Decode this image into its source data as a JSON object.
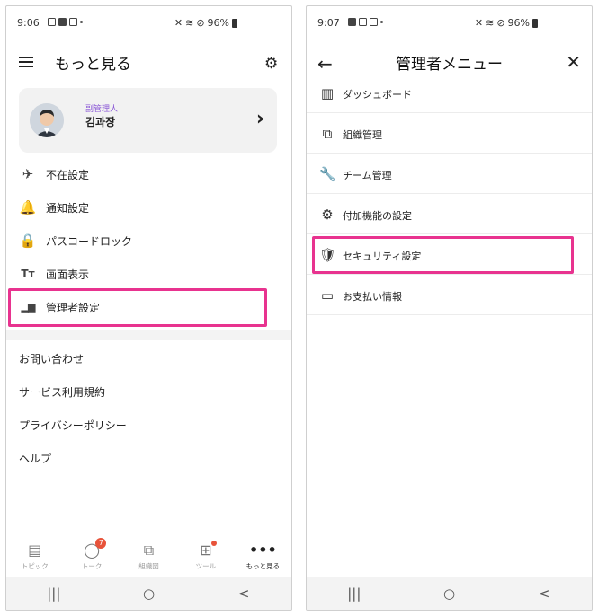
{
  "left": {
    "status": {
      "time": "9:06",
      "battery": "96%"
    },
    "title": "もっと見る",
    "profile": {
      "role": "副管理人",
      "name": "김과장"
    },
    "menu": [
      {
        "icon": "airplane-icon",
        "glyph": "✈",
        "label": "不在設定"
      },
      {
        "icon": "bell-icon",
        "glyph": "🔔",
        "label": "通知設定"
      },
      {
        "icon": "lock-icon",
        "glyph": "🔒",
        "label": "パスコードロック"
      },
      {
        "icon": "text-size-icon",
        "glyph": "Tт",
        "label": "画面表示"
      },
      {
        "icon": "bar-chart-icon",
        "glyph": "▂▆",
        "label": "管理者設定"
      }
    ],
    "links": [
      "お問い合わせ",
      "サービス利用規約",
      "プライバシーポリシー",
      "ヘルプ"
    ],
    "nav": [
      {
        "label": "トピック",
        "glyph": "▤"
      },
      {
        "label": "トーク",
        "glyph": "◯",
        "badge": "7"
      },
      {
        "label": "組織図",
        "glyph": "⧉"
      },
      {
        "label": "ツール",
        "glyph": "⊞"
      },
      {
        "label": "もっと見る",
        "glyph": "•••"
      }
    ]
  },
  "right": {
    "status": {
      "time": "9:07",
      "battery": "96%"
    },
    "title": "管理者メニュー",
    "menu": [
      {
        "icon": "dashboard-icon",
        "glyph": "▥",
        "label": "ダッシュボード"
      },
      {
        "icon": "org-tree-icon",
        "glyph": "⧉",
        "label": "組織管理"
      },
      {
        "icon": "wrench-icon",
        "glyph": "🔧",
        "label": "チーム管理"
      },
      {
        "icon": "gear-icon",
        "glyph": "⚙",
        "label": "付加機能の設定"
      },
      {
        "icon": "shield-check-icon",
        "glyph": "🛡",
        "label": "セキュリティ設定"
      },
      {
        "icon": "credit-card-icon",
        "glyph": "▭",
        "label": "お支払い情報"
      }
    ]
  },
  "system_nav": {
    "recents": "|||",
    "home": "○",
    "back": "<"
  },
  "colors": {
    "highlight": "#e8338f",
    "role": "#8a57d6",
    "badge": "#e8533a"
  }
}
